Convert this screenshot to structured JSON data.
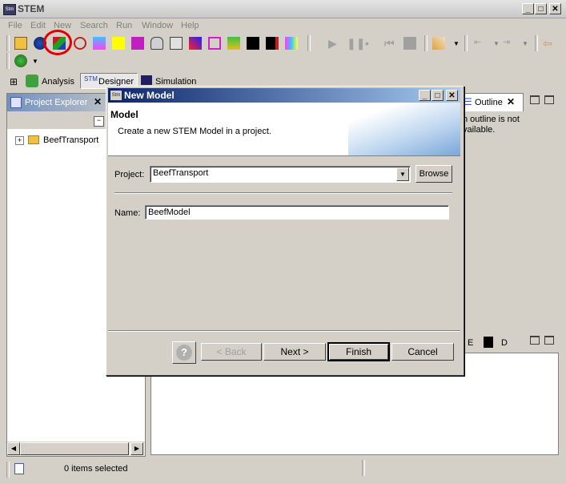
{
  "app": {
    "title": "STEM",
    "icon_text": "Stm"
  },
  "menu": [
    "File",
    "Edit",
    "New",
    "Search",
    "Run",
    "Window",
    "Help"
  ],
  "perspectives": {
    "analysis": "Analysis",
    "designer": "Designer",
    "simulation": "Simulation"
  },
  "project_explorer": {
    "title": "Project Explorer",
    "tree": [
      {
        "label": "BeefTransport",
        "expanded": false
      }
    ]
  },
  "outline": {
    "title": "Outline",
    "message_line1": "n outline is not",
    "message_line2": "vailable."
  },
  "bottom_tabs": {
    "tab_e": "E",
    "tab_d": "D"
  },
  "status": {
    "text": "0 items selected"
  },
  "dialog": {
    "title": "New Model",
    "icon_text": "Stm",
    "heading": "Model",
    "description": "Create a new STEM Model in a project.",
    "project_label": "Project:",
    "project_value": "BeefTransport",
    "browse_label": "Browse",
    "name_label": "Name:",
    "name_value": "BeefModel",
    "back_label": "< Back",
    "next_label": "Next >",
    "finish_label": "Finish",
    "cancel_label": "Cancel",
    "help_symbol": "?"
  },
  "colors": {
    "accent_title": "#0a246a",
    "highlight_circle": "#e00000"
  }
}
